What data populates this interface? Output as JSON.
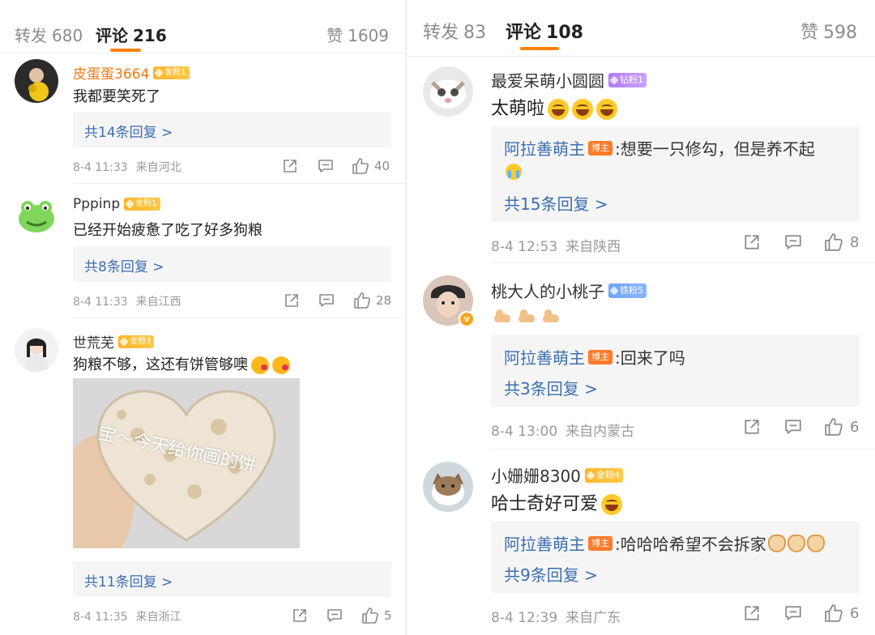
{
  "left_panel": {
    "tabs": {
      "repost_label": "转发",
      "repost_count": "680",
      "comment_label": "评论",
      "comment_count": "216",
      "like_label": "赞",
      "like_count": "1609"
    },
    "comments": [
      {
        "username": "皮蛋蛋3664",
        "badge": "金粉1",
        "text": "我都要笑死了",
        "replies_more": "共14条回复 >",
        "time": "8-4 11:33",
        "location": "来自河北",
        "likes": "40"
      },
      {
        "username": "Pppinp",
        "badge": "金粉1",
        "text": "已经开始疲惫了吃了好多狗粮",
        "replies_more": "共8条回复 >",
        "time": "8-4 11:33",
        "location": "来自江西",
        "likes": "28"
      },
      {
        "username": "世荒芜",
        "badge": "金粉3",
        "text": "狗粮不够，这还有饼管够噢",
        "image_caption": "宝～今天给你画的饼",
        "replies_more": "共11条回复 >",
        "time": "8-4 11:35",
        "location": "来自浙江",
        "likes": "5"
      }
    ]
  },
  "right_panel": {
    "tabs": {
      "repost_label": "转发",
      "repost_count": "83",
      "comment_label": "评论",
      "comment_count": "108",
      "like_label": "赞",
      "like_count": "598"
    },
    "comments": [
      {
        "username": "最爱呆萌小圆圆",
        "badge": "钻粉1",
        "text": "太萌啦",
        "reply_author": "阿拉善萌主",
        "author_tag": "博主",
        "reply_text": ":想要一只修勾，但是养不起",
        "replies_more": "共15条回复 >",
        "time": "8-4 12:53",
        "location": "来自陕西",
        "likes": "8"
      },
      {
        "username": "桃大人的小桃子",
        "badge": "铁粉5",
        "reply_author": "阿拉善萌主",
        "author_tag": "博主",
        "reply_text": ":回来了吗",
        "replies_more": "共3条回复 >",
        "time": "8-4 13:00",
        "location": "来自内蒙古",
        "likes": "6"
      },
      {
        "username": "小姗姗8300",
        "badge": "金粉4",
        "text": "哈士奇好可爱",
        "reply_author": "阿拉善萌主",
        "author_tag": "博主",
        "reply_text": ":哈哈哈希望不会拆家",
        "replies_more": "共9条回复 >",
        "time": "8-4 12:39",
        "location": "来自广东",
        "likes": "6"
      }
    ]
  },
  "icons": [
    "share-icon",
    "comment-icon",
    "like-icon",
    "verified-icon"
  ],
  "colors": {
    "accent": "#ff8200",
    "link": "#3b6fb0",
    "username_highlight": "#f07a14",
    "author_tag": "#ff7a2a"
  }
}
